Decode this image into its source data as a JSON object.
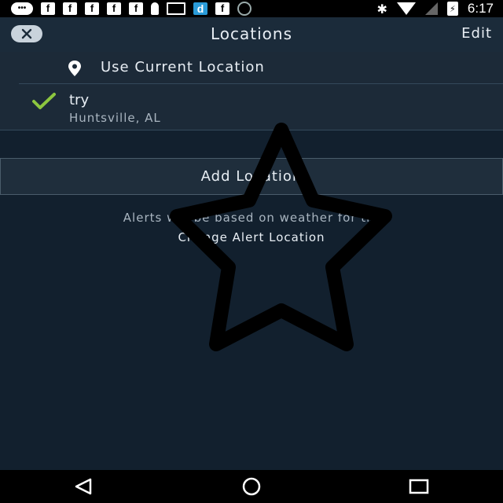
{
  "status_bar": {
    "time": "6:17",
    "notification_icons": [
      "message-icon",
      "facebook-icon",
      "facebook-icon",
      "facebook-icon",
      "facebook-icon",
      "facebook-icon",
      "ghost-icon",
      "mail-icon",
      "d-app-icon",
      "facebook-icon",
      "circle-icon"
    ],
    "fb_letter": "f",
    "d_letter": "d"
  },
  "header": {
    "title": "Locations",
    "edit_label": "Edit"
  },
  "locations": {
    "current_label": "Use Current Location",
    "saved": [
      {
        "name": "try",
        "subtitle": "Huntsville, AL",
        "selected": true
      }
    ]
  },
  "add_location_label": "Add Location",
  "alerts_note": "Alerts will be based on weather for try",
  "change_alert_label": "Change Alert Location",
  "colors": {
    "background": "#12202e",
    "check": "#8cc63f"
  }
}
